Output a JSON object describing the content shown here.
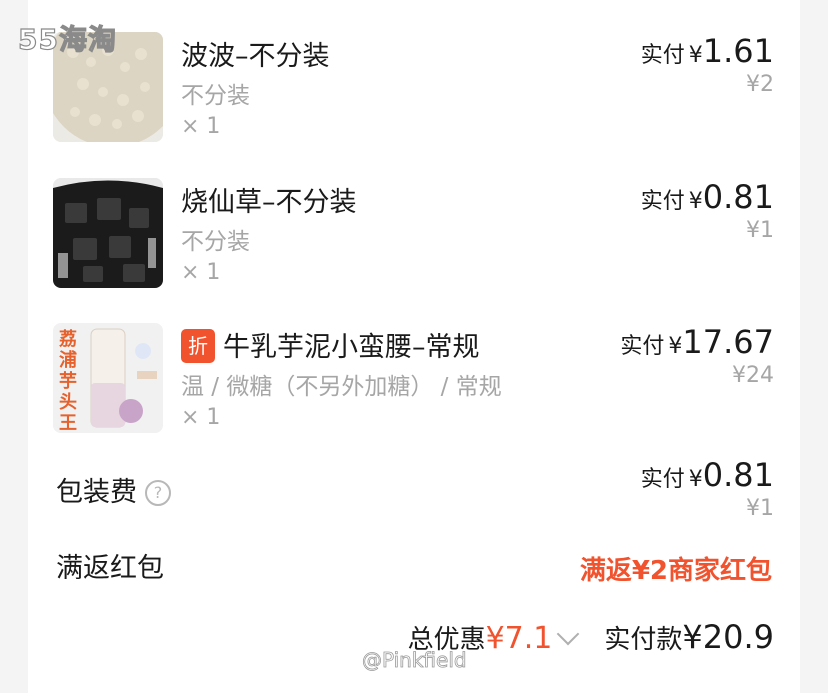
{
  "watermark_top": "55海淘",
  "watermark_bottom": "@Pinkfield",
  "items": [
    {
      "title": "波波–不分装",
      "spec": "不分装",
      "qty": "× 1",
      "paid_label": "实付",
      "currency": "¥",
      "paid_amount": "1.61",
      "original_price": "¥2",
      "has_discount_badge": false
    },
    {
      "title": "烧仙草–不分装",
      "spec": "不分装",
      "qty": "× 1",
      "paid_label": "实付",
      "currency": "¥",
      "paid_amount": "0.81",
      "original_price": "¥1",
      "has_discount_badge": false
    },
    {
      "title": "牛乳芋泥小蛮腰–常规",
      "spec": "温 / 微糖（不另外加糖） / 常规",
      "qty": "× 1",
      "paid_label": "实付",
      "currency": "¥",
      "paid_amount": "17.67",
      "original_price": "¥24",
      "has_discount_badge": true,
      "badge_text": "折",
      "cup_text": "荔浦芋头王"
    }
  ],
  "packaging": {
    "label": "包装费",
    "help_icon": "?",
    "paid_label": "实付",
    "currency": "¥",
    "paid_amount": "0.81",
    "original_price": "¥1"
  },
  "red_packet": {
    "label": "满返红包",
    "value": "满返¥2商家红包"
  },
  "summary": {
    "discount_label": "总优惠",
    "discount_value": "¥7.1",
    "total_label": "实付款",
    "total_value": "¥20.9"
  },
  "colors": {
    "accent": "#f0532e",
    "muted": "#a6a6a6",
    "text": "#1a1a1a"
  }
}
